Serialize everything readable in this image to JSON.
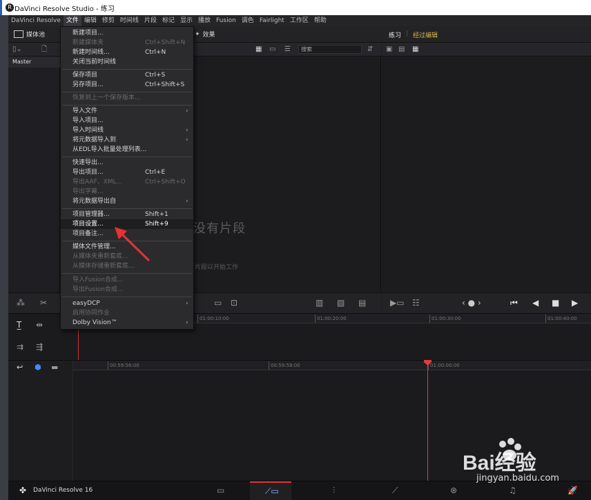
{
  "window": {
    "title": "DaVinci Resolve Studio - 练习",
    "logo": "R"
  },
  "menubar": [
    "DaVinci Resolve",
    "文件",
    "编辑",
    "修剪",
    "时间线",
    "片段",
    "标记",
    "显示",
    "播放",
    "Fusion",
    "调色",
    "Fairlight",
    "工作区",
    "帮助"
  ],
  "toolbar": {
    "media_pool": "媒体池",
    "effects": "效果",
    "project_name": "练习",
    "timeline_name": "经过编辑",
    "search_placeholder": "搜索"
  },
  "media": {
    "master": "Master",
    "empty_title": "没有片段",
    "empty_hint": "片段以开始工作"
  },
  "file_menu": {
    "items": [
      {
        "label": "新建项目...",
        "shortcut": "",
        "disabled": false,
        "arrow": false
      },
      {
        "label": "新建媒体夹",
        "shortcut": "Ctrl+Shift+N",
        "disabled": true,
        "arrow": false
      },
      {
        "label": "新建时间线...",
        "shortcut": "Ctrl+N",
        "disabled": false,
        "arrow": false
      },
      {
        "label": "关闭当前时间线",
        "shortcut": "",
        "disabled": false,
        "arrow": false
      },
      {
        "label": "保存项目",
        "shortcut": "Ctrl+S",
        "disabled": false,
        "arrow": false
      },
      {
        "label": "另存项目...",
        "shortcut": "Ctrl+Shift+S",
        "disabled": false,
        "arrow": false
      },
      {
        "label": "恢复到上一个保存版本...",
        "shortcut": "",
        "disabled": true,
        "arrow": false
      },
      {
        "label": "导入文件",
        "shortcut": "",
        "disabled": false,
        "arrow": true
      },
      {
        "label": "导入项目...",
        "shortcut": "",
        "disabled": false,
        "arrow": false
      },
      {
        "label": "导入时间线",
        "shortcut": "",
        "disabled": false,
        "arrow": true
      },
      {
        "label": "将元数据导入到",
        "shortcut": "",
        "disabled": false,
        "arrow": true
      },
      {
        "label": "从EDL导入批量处理列表...",
        "shortcut": "",
        "disabled": false,
        "arrow": false
      },
      {
        "label": "快速导出...",
        "shortcut": "",
        "disabled": false,
        "arrow": false
      },
      {
        "label": "导出项目...",
        "shortcut": "Ctrl+E",
        "disabled": false,
        "arrow": false
      },
      {
        "label": "导出AAF、XML...",
        "shortcut": "Ctrl+Shift+O",
        "disabled": true,
        "arrow": false
      },
      {
        "label": "导出字幕...",
        "shortcut": "",
        "disabled": true,
        "arrow": false
      },
      {
        "label": "将元数据导出自",
        "shortcut": "",
        "disabled": false,
        "arrow": true
      },
      {
        "label": "项目管理器...",
        "shortcut": "Shift+1",
        "disabled": false,
        "arrow": false
      },
      {
        "label": "项目设置...",
        "shortcut": "Shift+9",
        "disabled": false,
        "arrow": false,
        "highlight": true
      },
      {
        "label": "项目备注...",
        "shortcut": "",
        "disabled": false,
        "arrow": false
      },
      {
        "label": "媒体文件管理...",
        "shortcut": "",
        "disabled": false,
        "arrow": false
      },
      {
        "label": "从媒体夹重新套底...",
        "shortcut": "",
        "disabled": true,
        "arrow": false
      },
      {
        "label": "从媒体存储重新套底...",
        "shortcut": "",
        "disabled": true,
        "arrow": false
      },
      {
        "label": "导入Fusion合成...",
        "shortcut": "",
        "disabled": true,
        "arrow": false
      },
      {
        "label": "导出Fusion合成...",
        "shortcut": "",
        "disabled": true,
        "arrow": false
      },
      {
        "label": "easyDCP",
        "shortcut": "",
        "disabled": false,
        "arrow": true
      },
      {
        "label": "启用协同作业",
        "shortcut": "",
        "disabled": true,
        "arrow": false
      },
      {
        "label": "Dolby Vision™",
        "shortcut": "",
        "disabled": false,
        "arrow": true
      }
    ]
  },
  "timeline": {
    "upper_ticks": [
      "01:00:10:00",
      "01:00:20:00",
      "01:00:30:00",
      "01:00:40:00"
    ],
    "lower_ticks": [
      "00:59:56:00",
      "00:59:58:00",
      "01:00:00:00"
    ]
  },
  "bottombar": {
    "app": "DaVinci Resolve 16"
  },
  "watermark": {
    "text": "Bai经验",
    "url": "jingyan.baidu.com"
  }
}
